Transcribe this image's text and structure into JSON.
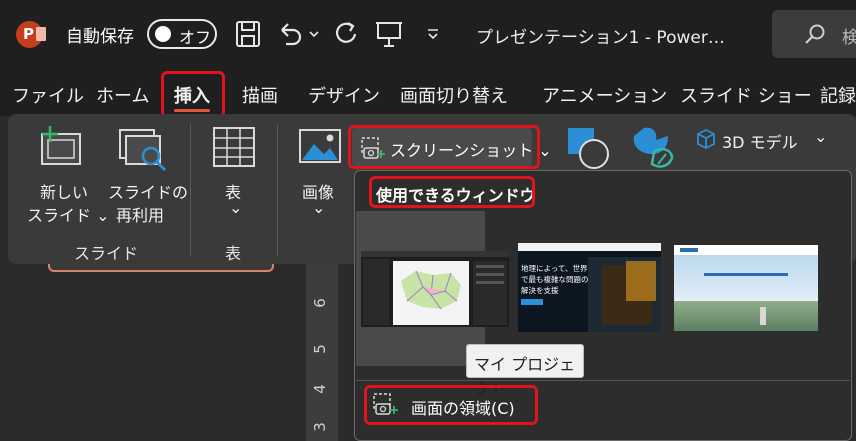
{
  "titlebar": {
    "autosave_label": "自動保存",
    "autosave_state": "オフ",
    "doc_title": "プレゼンテーション1  -  Power…",
    "search_text": "検"
  },
  "tabs": [
    {
      "label": "ファイル"
    },
    {
      "label": "ホーム"
    },
    {
      "label": "挿入",
      "active": true
    },
    {
      "label": "描画"
    },
    {
      "label": "デザイン"
    },
    {
      "label": "画面切り替え"
    },
    {
      "label": "アニメーション"
    },
    {
      "label": "スライド ショー"
    },
    {
      "label": "記録"
    }
  ],
  "ribbon": {
    "new_slide_line1": "新しい",
    "new_slide_line2": "スライド ⌄",
    "reuse_line1": "スライドの",
    "reuse_line2": "再利用",
    "slides_group": "スライド",
    "table_label": "表",
    "table_chevron": "⌄",
    "table_group": "表",
    "image_label": "画像",
    "image_chevron": "⌄",
    "screenshot_label": "スクリーンショット ⌄",
    "model_3d_label": "3D モデル",
    "model_3d_chevron": "⌄"
  },
  "ruler": {
    "n6": "6",
    "n5": "5",
    "n4": "4",
    "n3": "3"
  },
  "dropdown": {
    "heading": "使用できるウィンドウ",
    "tooltip": "マイ プロジェクト",
    "screen_clip_label": "画面の領域(C)",
    "thumb2_text_l1": "地理によって、世界",
    "thumb2_text_l2": "で最も複雑な問題の",
    "thumb2_text_l3": "解決を支援"
  },
  "colors": {
    "accent_red": "#e0141a",
    "tab_underline": "#e05a3a",
    "ppt_logo": "#c43e1c",
    "icon_blue": "#2b8fd6",
    "icon_teal": "#3ab7a5"
  }
}
